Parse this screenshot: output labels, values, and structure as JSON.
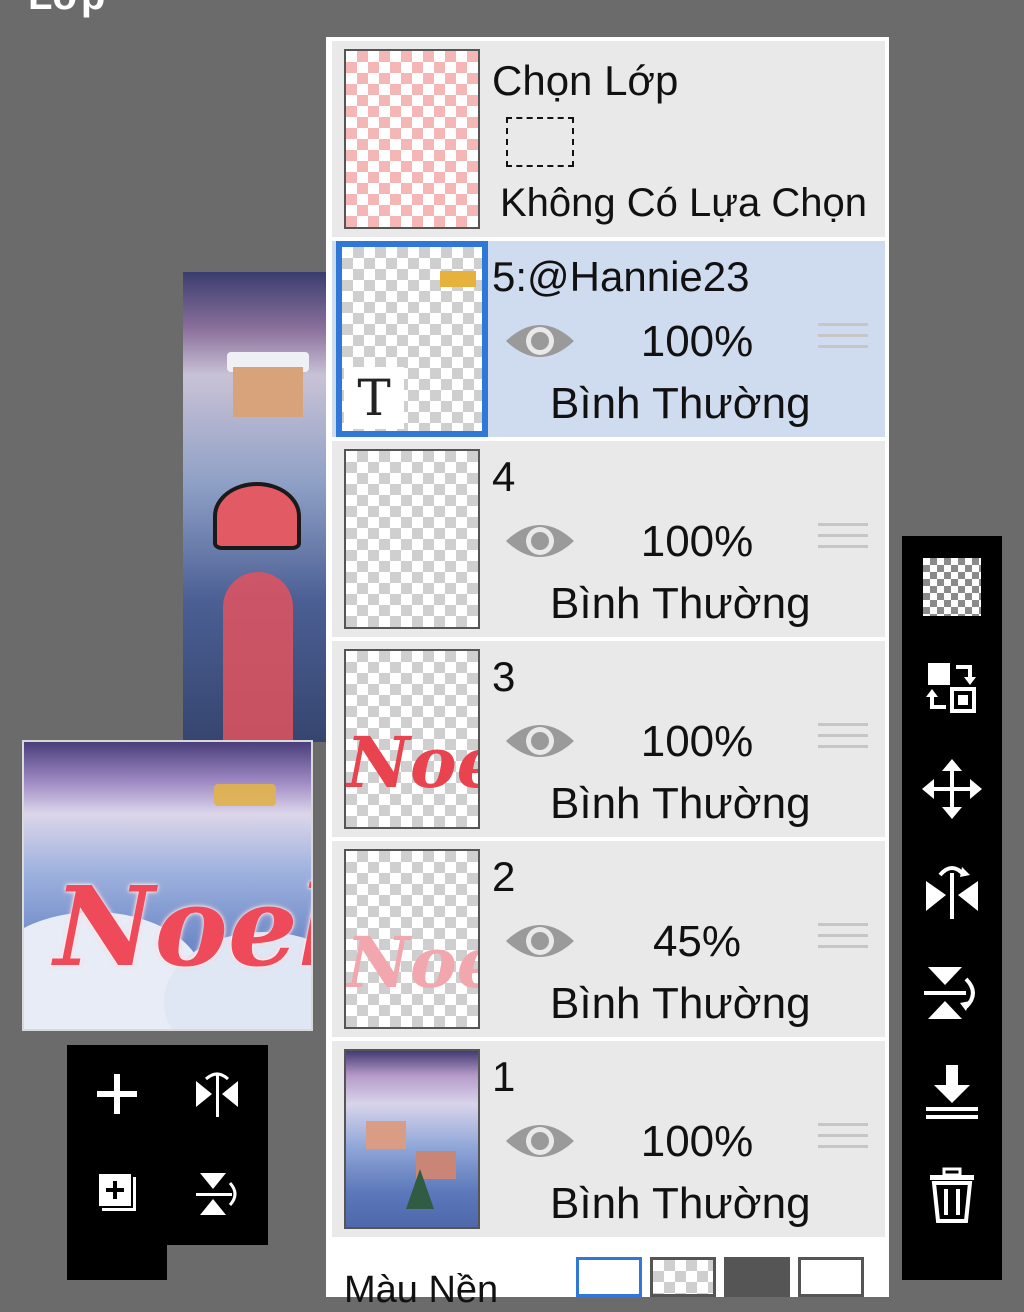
{
  "screen": {
    "title": "Lớp"
  },
  "selection": {
    "title": "Chọn Lớp",
    "status": "Không Có Lựa Chọn"
  },
  "layers": [
    {
      "name": "5:@Hannie23",
      "opacity": "100%",
      "blend": "Bình Thường",
      "selected": true,
      "type": "text"
    },
    {
      "name": "4",
      "opacity": "100%",
      "blend": "Bình Thường",
      "selected": false,
      "type": "empty"
    },
    {
      "name": "3",
      "opacity": "100%",
      "blend": "Bình Thường",
      "selected": false,
      "type": "noel"
    },
    {
      "name": "2",
      "opacity": "45%",
      "blend": "Bình Thường",
      "selected": false,
      "type": "noel-faded"
    },
    {
      "name": "1",
      "opacity": "100%",
      "blend": "Bình Thường",
      "selected": false,
      "type": "scene"
    }
  ],
  "thumb_text": {
    "t_badge": "T",
    "noel": "Noel",
    "preview_noel": "Noel"
  },
  "bottom": {
    "label": "Màu Nền"
  },
  "colors": {
    "selected_border": "#2f78d8",
    "selected_row": "#cfdcef",
    "row": "#e9e9e9",
    "toolbar": "#000000"
  },
  "icons": {
    "left_toolbar": [
      "plus-icon",
      "flip-horizontal-icon",
      "add-layer-icon",
      "flip-vertical-icon"
    ],
    "right_toolbar": [
      "transparency-icon",
      "swap-layers-icon",
      "move-icon",
      "flip-horizontal-icon",
      "flip-vertical-icon",
      "merge-down-icon",
      "trash-icon"
    ]
  }
}
